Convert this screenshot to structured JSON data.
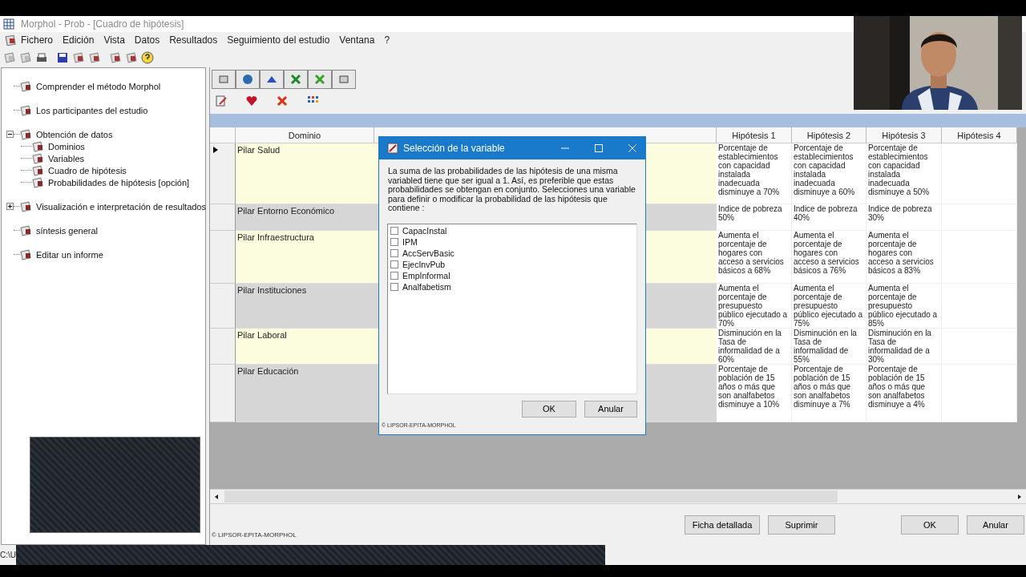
{
  "window": {
    "title": "Morphol - Prob - [Cuadro de hipótesis]"
  },
  "menu": [
    "Fichero",
    "Edición",
    "Vista",
    "Datos",
    "Resultados",
    "Seguimiento del estudio",
    "Ventana",
    "?"
  ],
  "tree": [
    {
      "label": "Comprender el método Morphol"
    },
    {
      "label": "Los participantes del estudio"
    },
    {
      "label": "Obtención de datos",
      "expanded": true,
      "children": [
        {
          "label": "Dominios"
        },
        {
          "label": "Variables"
        },
        {
          "label": "Cuadro de hipótesis"
        },
        {
          "label": "Probabilidades de hipótesis [opción]"
        }
      ]
    },
    {
      "label": "Visualización e interpretación de resultados",
      "expanded": false
    },
    {
      "label": "síntesis general"
    },
    {
      "label": "Editar un informe"
    }
  ],
  "grid": {
    "columns": [
      "Dominio",
      "Hipótesis 1",
      "Hipótesis 2",
      "Hipótesis 3",
      "Hipótesis 4"
    ],
    "rows": [
      {
        "selected": true,
        "dominio": "Pilar Salud",
        "hypotheses": [
          "Porcentaje de establecimientos con capacidad instalada inadecuada disminuye a 70%",
          "Porcentaje de establecimientos con capacidad instalada inadecuada disminuye  a 60%",
          "Porcentaje de establecimientos con capacidad instalada inadecuada disminuye  a 50%"
        ]
      },
      {
        "selected": false,
        "dominio": "Pilar Entorno Económico",
        "hypotheses": [
          "Indice de pobreza 50%",
          "Indice de pobreza 40%",
          "Indice de pobreza 30%"
        ]
      },
      {
        "selected": false,
        "dominio": "Pilar Infraestructura",
        "hypotheses": [
          "Aumenta el porcentaje de hogares con acceso a servicios básicos a 68%",
          "Aumenta el porcentaje de hogares con acceso a servicios básicos a 76%",
          "Aumenta el porcentaje de hogares con acceso a servicios básicos  a 83%"
        ]
      },
      {
        "selected": false,
        "dominio": "Pilar Instituciones",
        "hypotheses": [
          "Aumenta el porcentaje de presupuesto público ejecutado a 70%",
          "Aumenta el porcentaje de presupuesto público ejecutado a 75%",
          "Aumenta el porcentaje de presupuesto público ejecutado a 85%"
        ]
      },
      {
        "selected": false,
        "dominio": "Pilar Laboral",
        "hypotheses": [
          "Disminución en la Tasa de informalidad de a 60%",
          "Disminución en la Tasa de informalidad de 55%",
          "Disminución en la Tasa de informalidad de a 30%"
        ]
      },
      {
        "selected": false,
        "dominio": "Pilar Educación",
        "hypotheses": [
          "Porcentaje de población de 15 años o más que son analfabetos disminuye a 10%",
          "Porcentaje de población de 15 años o más que son analfabetos disminuye a 7%",
          "Porcentaje de población de 15 años o más que son analfabetos disminuye a 4%"
        ]
      }
    ]
  },
  "copyright": "© LIPSOR-EPITA-MORPHOL",
  "buttons": [
    "Ficha detallada",
    "Suprimir",
    "OK",
    "Anular"
  ],
  "status": "C:\\U",
  "dialog": {
    "title": "Selección de la variable",
    "message": "La suma de las probabilidades de las hipótesis de una misma variabled tiene que ser igual a 1. Así, es preferible que estas probabilidades se obtengan en conjunto. Selecciones una variable para definir o modificar la probabilidad de las hipótesis que contiene :",
    "variables": [
      {
        "label": "CapacInstal",
        "checked": false
      },
      {
        "label": "IPM",
        "checked": false
      },
      {
        "label": "AccServBasic",
        "checked": false
      },
      {
        "label": "EjecInvPub",
        "checked": false
      },
      {
        "label": "EmpInformal",
        "checked": false
      },
      {
        "label": "Analfabetism",
        "checked": false
      }
    ],
    "buttons": [
      "OK",
      "Anular"
    ],
    "copyright": "© LIPSOR-EPITA-MORPHOL"
  }
}
